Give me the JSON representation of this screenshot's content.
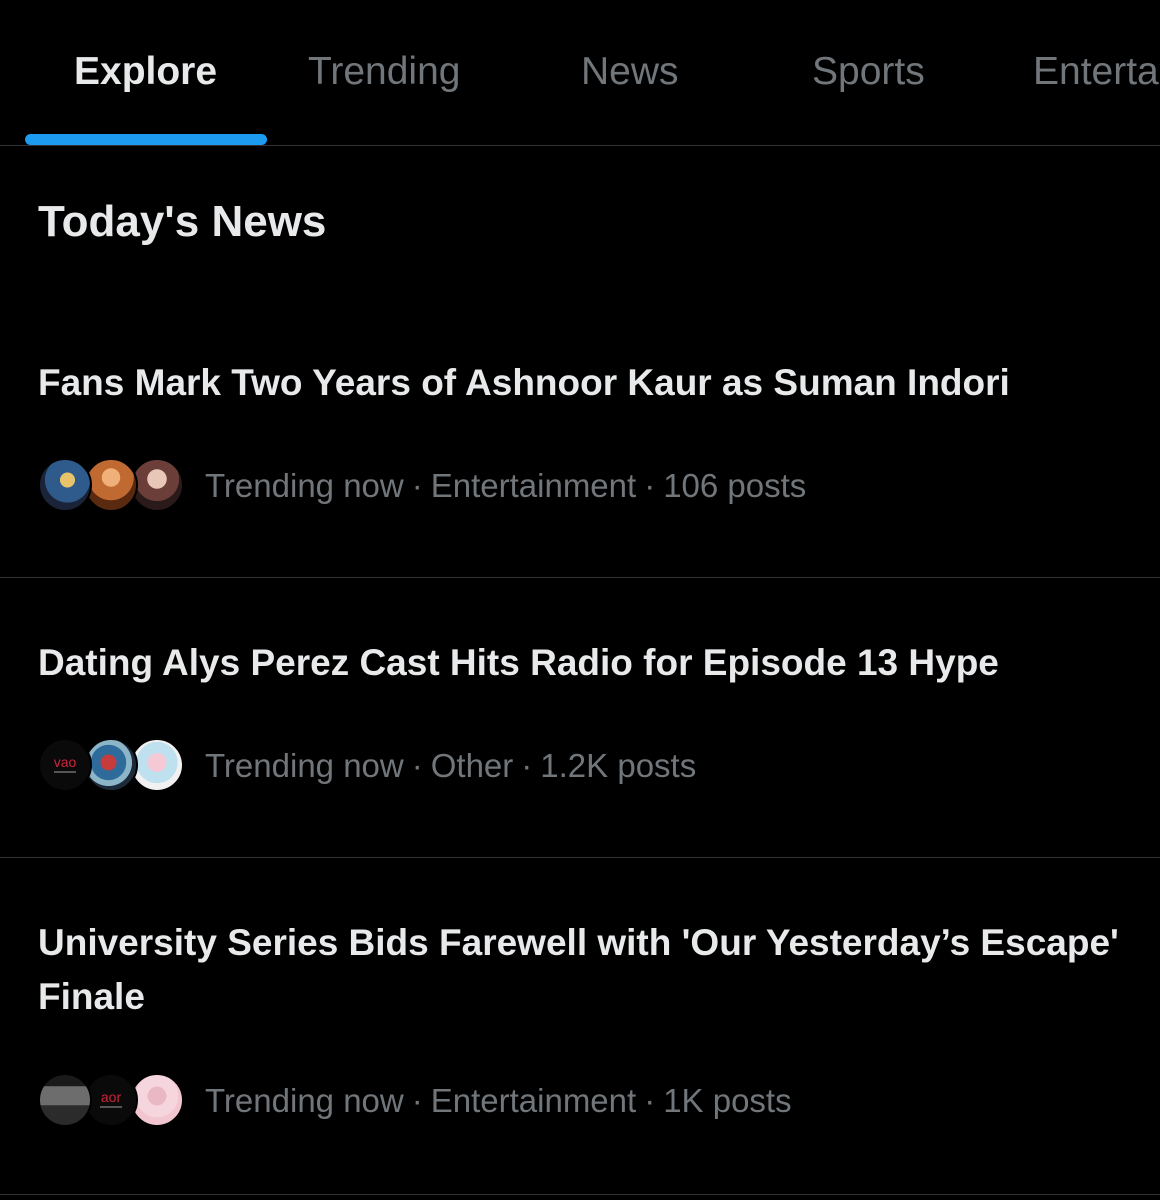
{
  "tabs": [
    {
      "label": "Explore",
      "active": true
    },
    {
      "label": "Trending",
      "active": false
    },
    {
      "label": "News",
      "active": false
    },
    {
      "label": "Sports",
      "active": false
    },
    {
      "label": "Entertainment",
      "active": false
    }
  ],
  "accent_color": "#1d9bf0",
  "section_title": "Today's News",
  "news": [
    {
      "headline": "Fans Mark Two Years of Ashnoor Kaur as Suman Indori",
      "status": "Trending now",
      "category": "Entertainment",
      "posts": "106 posts",
      "avatar_icons": [
        "avatar-photo-icon",
        "avatar-photo-icon",
        "avatar-photo-icon"
      ]
    },
    {
      "headline": "Dating Alys Perez Cast Hits Radio for Episode 13 Hype",
      "status": "Trending now",
      "category": "Other",
      "posts": "1.2K posts",
      "avatar_icons": [
        "agency-logo-icon",
        "avatar-photo-icon",
        "avatar-photo-icon"
      ]
    },
    {
      "headline": "University Series Bids Farewell with 'Our Yesterday’s Escape' Finale",
      "status": "Trending now",
      "category": "Entertainment",
      "posts": "1K posts",
      "avatar_icons": [
        "poster-thumbnail-icon",
        "agency-logo-icon",
        "avatar-photo-icon"
      ]
    }
  ]
}
